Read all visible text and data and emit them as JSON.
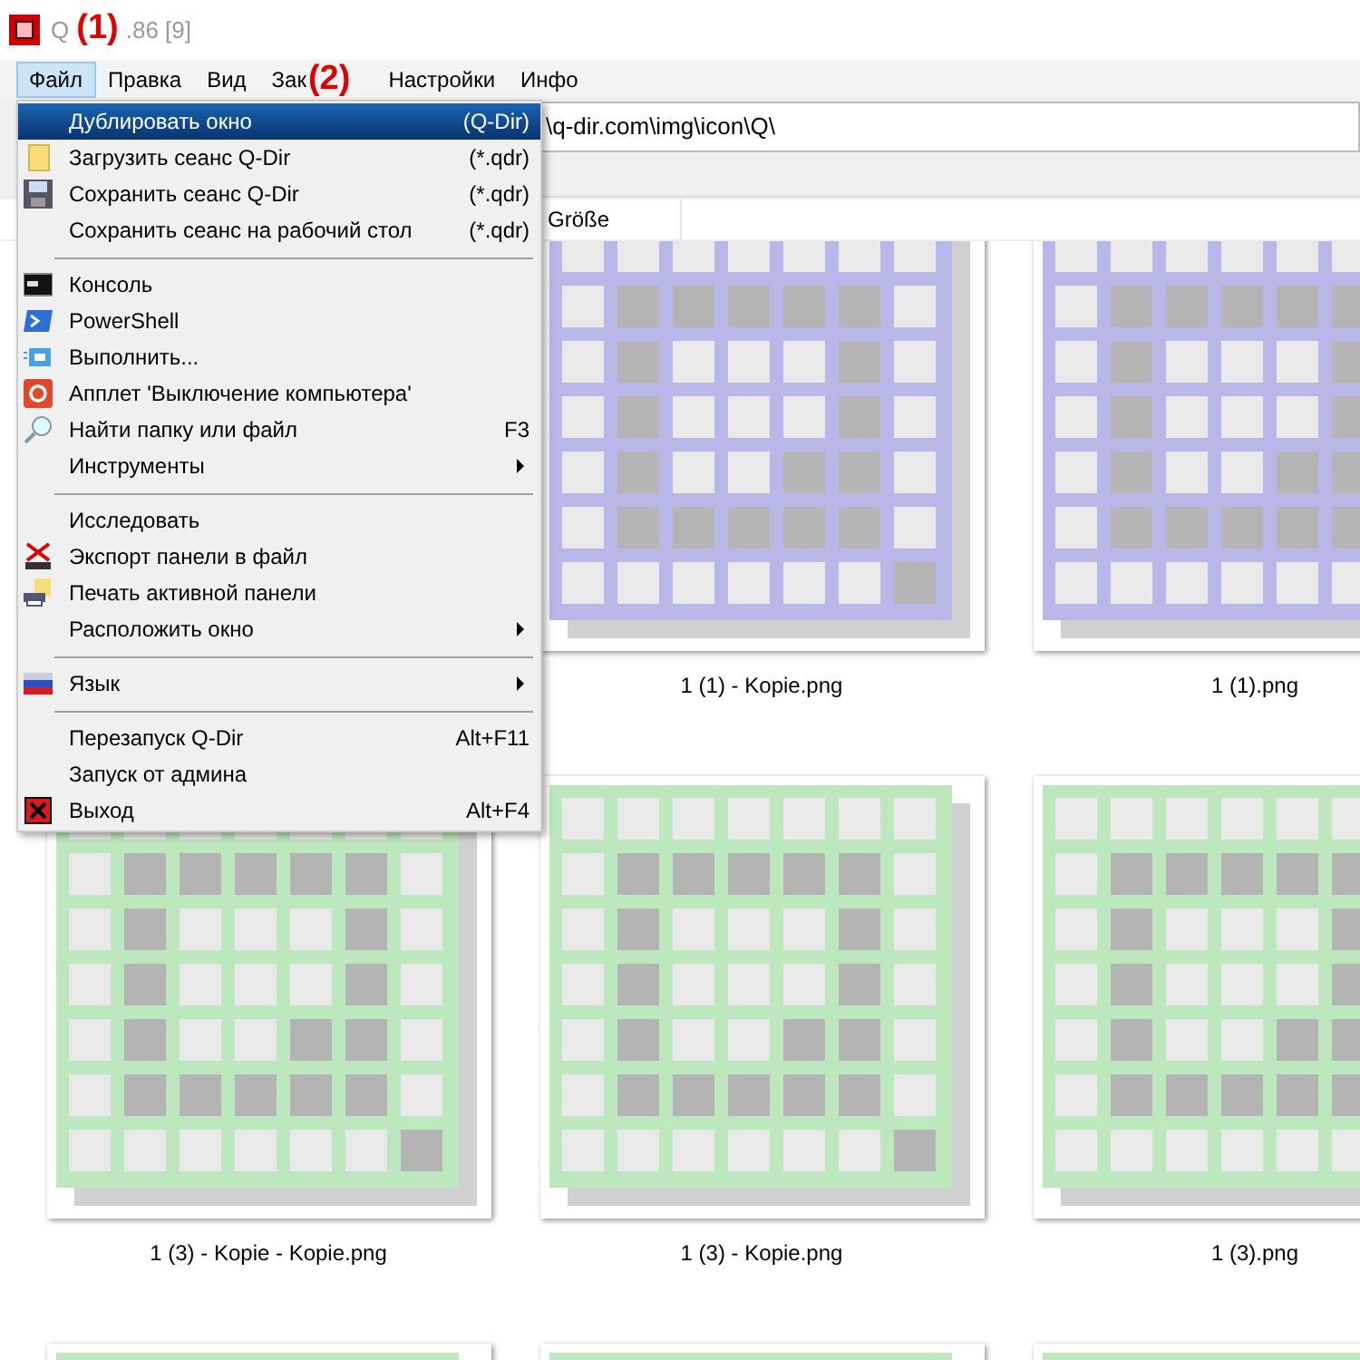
{
  "window": {
    "title_start": "Q",
    "title_end": ".86 [9]"
  },
  "annotations": [
    "(1)",
    "(2)"
  ],
  "menubar": [
    {
      "label": "Файл",
      "selected": true
    },
    {
      "label": "Правка",
      "selected": false
    },
    {
      "label": "Вид",
      "selected": false
    },
    {
      "label": "Зак",
      "selected": false
    },
    {
      "label": "Настройки",
      "selected": false
    },
    {
      "label": "Инфо",
      "selected": false
    }
  ],
  "address": "\\q-dir.com\\img\\icon\\Q\\",
  "columns": [
    "Größe"
  ],
  "menu": [
    {
      "kind": "item",
      "label": "Дублировать окно",
      "shortcut": "(Q-Dir)",
      "selected": true,
      "submenu": false
    },
    {
      "kind": "item",
      "label": "Загрузить сеанс Q-Dir",
      "shortcut": "(*.qdr)",
      "selected": false,
      "submenu": false
    },
    {
      "kind": "item",
      "label": "Сохранить сеанс Q-Dir",
      "shortcut": "(*.qdr)",
      "selected": false,
      "submenu": false
    },
    {
      "kind": "item",
      "label": "Сохранить сеанс на рабочий стол",
      "shortcut": "(*.qdr)",
      "selected": false,
      "submenu": false
    },
    {
      "kind": "separator"
    },
    {
      "kind": "item",
      "label": "Консоль",
      "selected": false,
      "submenu": false
    },
    {
      "kind": "item",
      "label": "PowerShell",
      "selected": false,
      "submenu": false
    },
    {
      "kind": "item",
      "label": "Выполнить...",
      "selected": false,
      "submenu": false
    },
    {
      "kind": "item",
      "label": "Апплет 'Выключение компьютера'",
      "selected": false,
      "submenu": false
    },
    {
      "kind": "item",
      "label": "Найти папку или файл",
      "shortcut": "F3",
      "selected": false,
      "submenu": false
    },
    {
      "kind": "item",
      "label": "Инструменты",
      "selected": false,
      "submenu": true
    },
    {
      "kind": "separator"
    },
    {
      "kind": "item",
      "label": "Исследовать",
      "selected": false,
      "submenu": false
    },
    {
      "kind": "item",
      "label": "Экспорт панели в файл",
      "selected": false,
      "submenu": false
    },
    {
      "kind": "item",
      "label": "Печать активной панели",
      "selected": false,
      "submenu": false
    },
    {
      "kind": "item",
      "label": "Расположить окно",
      "selected": false,
      "submenu": true
    },
    {
      "kind": "separator"
    },
    {
      "kind": "item",
      "label": "Язык",
      "selected": false,
      "submenu": true
    },
    {
      "kind": "separator"
    },
    {
      "kind": "item",
      "label": "Перезапуск Q-Dir",
      "shortcut": "Alt+F11",
      "selected": false,
      "submenu": false
    },
    {
      "kind": "item",
      "label": "Запуск от админа",
      "selected": false,
      "submenu": false
    },
    {
      "kind": "item",
      "label": "Выход",
      "shortcut": "Alt+F4",
      "selected": false,
      "submenu": false
    }
  ],
  "files": [
    {
      "name": "1 (1) - Kopie.png",
      "color": "#b8b8e8"
    },
    {
      "name": "1 (1).png",
      "color": "#b8b8e8"
    },
    {
      "name": "1 (3) - Kopie - Kopie.png",
      "color": "#bde8bd"
    },
    {
      "name": "1 (3) - Kopie.png",
      "color": "#bde8bd"
    },
    {
      "name": "1 (3).png",
      "color": "#bde8bd"
    },
    {
      "color": "#bde8bd"
    },
    {
      "color": "#bde8bd"
    },
    {
      "color": "#bde8bd"
    }
  ]
}
